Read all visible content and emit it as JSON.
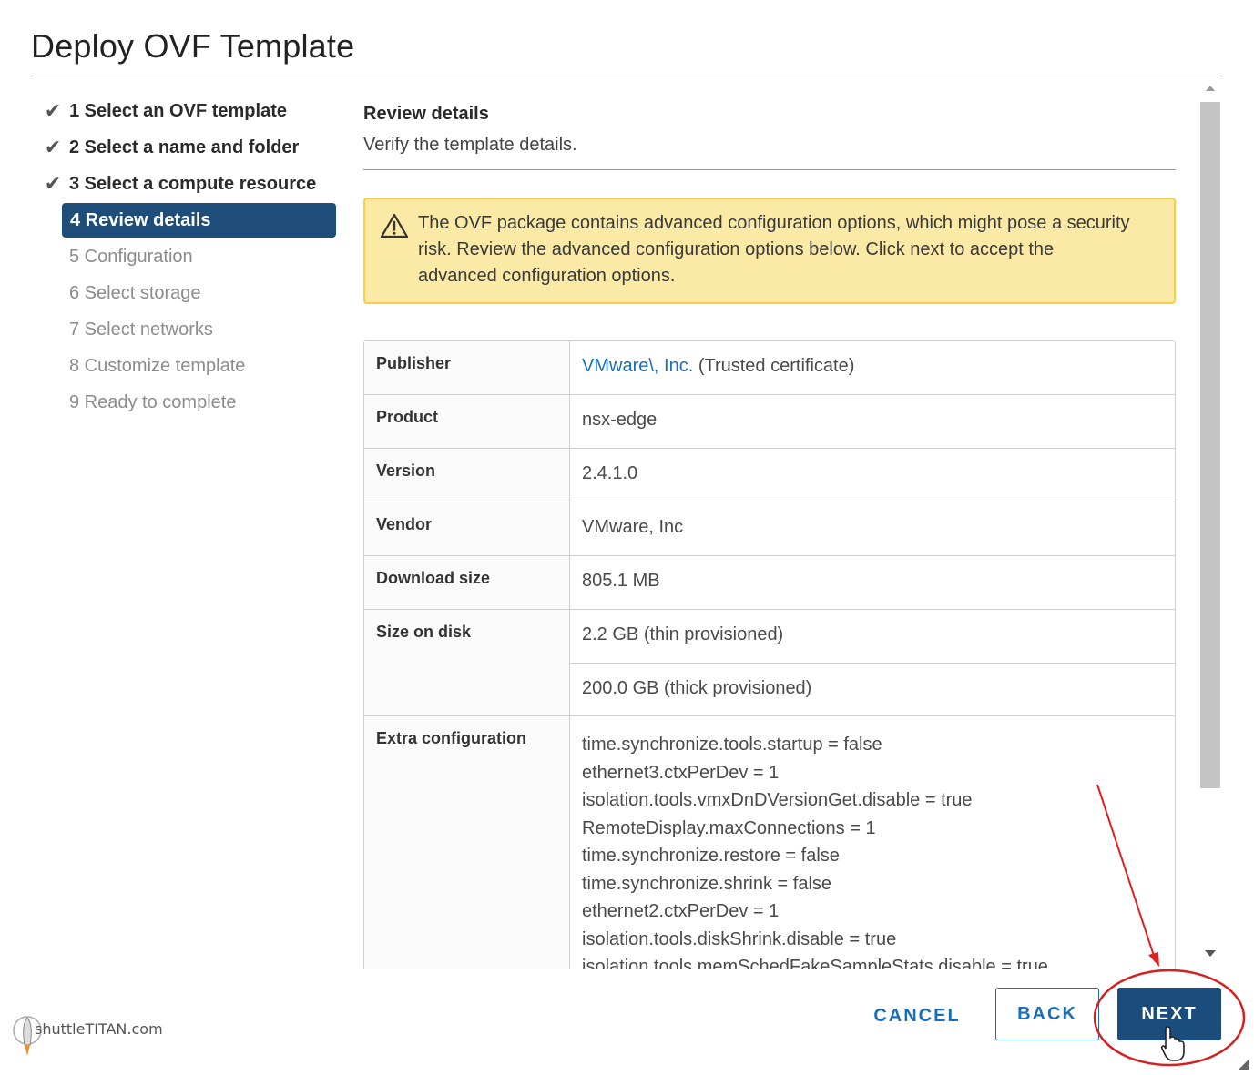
{
  "window": {
    "title": "Deploy OVF Template"
  },
  "steps": [
    {
      "label": "1 Select an OVF template",
      "state": "done"
    },
    {
      "label": "2 Select a name and folder",
      "state": "done"
    },
    {
      "label": "3 Select a compute resource",
      "state": "done"
    },
    {
      "label": "4 Review details",
      "state": "active"
    },
    {
      "label": "5 Configuration",
      "state": "pending"
    },
    {
      "label": "6 Select storage",
      "state": "pending"
    },
    {
      "label": "7 Select networks",
      "state": "pending"
    },
    {
      "label": "8 Customize template",
      "state": "pending"
    },
    {
      "label": "9 Ready to complete",
      "state": "pending"
    }
  ],
  "section": {
    "title": "Review details",
    "subtitle": "Verify the template details."
  },
  "alert": {
    "icon": "warning-icon",
    "message": "The OVF package contains advanced configuration options, which might pose a security risk. Review the advanced configuration options below. Click next to accept the advanced configuration options."
  },
  "details": {
    "publisher_label": "Publisher",
    "publisher_link": "VMware\\, Inc.",
    "publisher_cert": "(Trusted certificate)",
    "product_label": "Product",
    "product_value": "nsx-edge",
    "version_label": "Version",
    "version_value": "2.4.1.0",
    "vendor_label": "Vendor",
    "vendor_value": "VMware, Inc",
    "download_label": "Download size",
    "download_value": "805.1 MB",
    "disk_label": "Size on disk",
    "disk_thin": "2.2 GB (thin provisioned)",
    "disk_thick": "200.0 GB (thick provisioned)",
    "extra_label": "Extra configuration",
    "extra_lines": [
      "time.synchronize.tools.startup = false",
      "ethernet3.ctxPerDev = 1",
      "isolation.tools.vmxDnDVersionGet.disable = true",
      "RemoteDisplay.maxConnections = 1",
      "time.synchronize.restore = false",
      "time.synchronize.shrink = false",
      "ethernet2.ctxPerDev = 1",
      "isolation.tools.diskShrink.disable = true",
      "isolation.tools.memSchedFakeSampleStats.disable = true"
    ]
  },
  "footer": {
    "cancel_label": "CANCEL",
    "back_label": "BACK",
    "next_label": "NEXT"
  },
  "watermark": {
    "text": "shuttleTITAN.com"
  },
  "colors": {
    "accent": "#1a4d7c",
    "link": "#1a6fb6",
    "alert_bg": "#fbe9a6",
    "alert_border": "#f5cf45",
    "annotation": "#e02020"
  }
}
